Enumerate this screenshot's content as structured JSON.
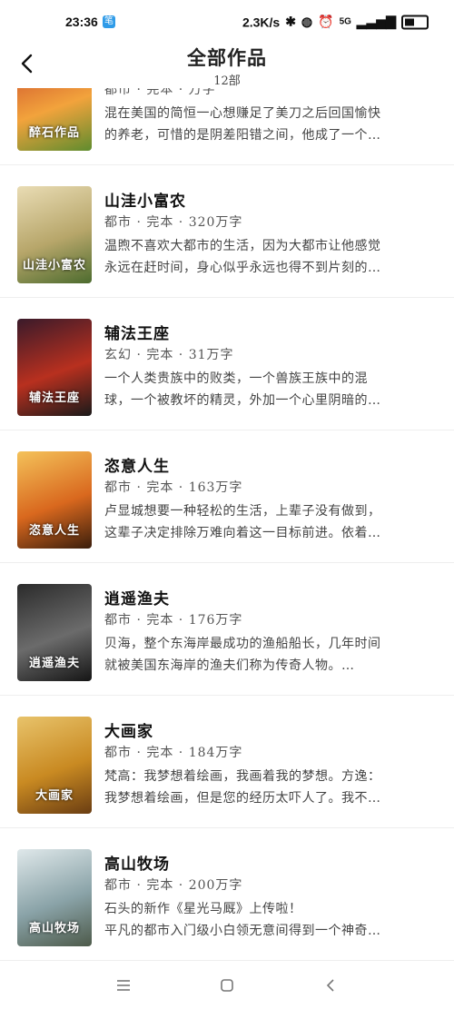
{
  "status": {
    "time": "23:36",
    "app_badge": "笔",
    "speed": "2.3K/s",
    "network": "5G"
  },
  "header": {
    "title": "全部作品",
    "subtitle": "12部"
  },
  "books": [
    {
      "title": "",
      "meta": "都市 · 完本 · 万字",
      "line1": "混在美国的简恒一心想赚足了美刀之后回国愉快",
      "line2": "的养老，可惜的是阴差阳错之间，他成了一个…",
      "cover_text": "醉石作品",
      "cover_colors": [
        "#c9472a",
        "#f2a33c",
        "#5f8c2e"
      ]
    },
    {
      "title": "山洼小富农",
      "meta": "都市 · 完本 · 320万字",
      "line1": "温煦不喜欢大都市的生活，因为大都市让他感觉",
      "line2": "永远在赶时间，身心似乎永远也得不到片刻的…",
      "cover_text": "山洼小富农",
      "cover_colors": [
        "#e9dcb4",
        "#b7a66a",
        "#4c6b2e"
      ]
    },
    {
      "title": "辅法王座",
      "meta": "玄幻 · 完本 · 31万字",
      "line1": "一个人类贵族中的败类，一个兽族王族中的混",
      "line2": "球，一个被教坏的精灵，外加一个心里阴暗的…",
      "cover_text": "辅法王座",
      "cover_colors": [
        "#3a1a2a",
        "#b8301f",
        "#1a1a1a"
      ]
    },
    {
      "title": "恣意人生",
      "meta": "都市 · 完本 · 163万字",
      "line1": "卢显城想要一种轻松的生活，上辈子没有做到，",
      "line2": "这辈子决定排除万难向着这一目标前进。依着…",
      "cover_text": "恣意人生",
      "cover_colors": [
        "#f4c25a",
        "#d9681e",
        "#3b1e0c"
      ]
    },
    {
      "title": "逍遥渔夫",
      "meta": "都市 · 完本 · 176万字",
      "line1": "贝海，整个东海岸最成功的渔船船长，几年时间",
      "line2": "就被美国东海岸的渔夫们称为传奇人物。…",
      "cover_text": "逍遥渔夫",
      "cover_colors": [
        "#2b2b2b",
        "#6b6b6b",
        "#151515"
      ]
    },
    {
      "title": "大画家",
      "meta": "都市 · 完本 · 184万字",
      "line1": "梵高：我梦想着绘画，我画着我的梦想。方逸：",
      "line2": "我梦想着绘画，但是您的经历太吓人了。我不…",
      "cover_text": "大画家",
      "cover_colors": [
        "#e8c36b",
        "#c98a22",
        "#6a3d12"
      ]
    },
    {
      "title": "高山牧场",
      "meta": "都市 · 完本 · 200万字",
      "line1": "石头的新作《星光马厩》上传啦！",
      "line2": "平凡的都市入门级小白领无意间得到一个神奇…",
      "cover_text": "高山牧场",
      "cover_colors": [
        "#dfe8ea",
        "#8aa3a8",
        "#4d5a4a"
      ]
    }
  ],
  "colors": {
    "background": "#ffffff",
    "title_text": "#111111",
    "meta_text": "#555555",
    "divider": "#eeeeee"
  }
}
